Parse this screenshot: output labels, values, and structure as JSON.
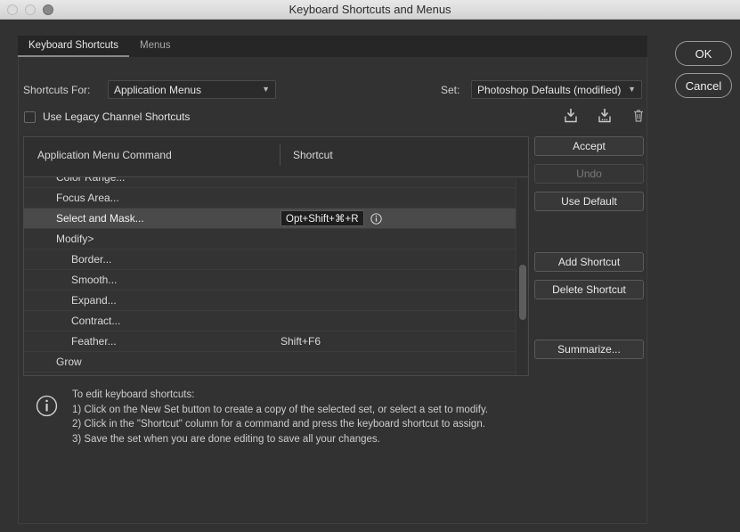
{
  "window": {
    "title": "Keyboard Shortcuts and Menus",
    "traffic_lights": [
      "close",
      "minimize",
      "zoom"
    ]
  },
  "tabs": [
    {
      "label": "Keyboard Shortcuts",
      "selected": true
    },
    {
      "label": "Menus",
      "selected": false
    }
  ],
  "controls": {
    "shortcuts_for_label": "Shortcuts For:",
    "shortcuts_for_value": "Application Menus",
    "set_label": "Set:",
    "set_value": "Photoshop Defaults (modified)",
    "legacy_checkbox_label": "Use Legacy Channel Shortcuts",
    "legacy_checkbox_checked": false
  },
  "set_icons": [
    {
      "name": "save-set-icon"
    },
    {
      "name": "save-set-as-icon"
    },
    {
      "name": "delete-set-icon"
    }
  ],
  "table": {
    "columns": [
      "Application Menu Command",
      "Shortcut"
    ],
    "rows": [
      {
        "command": "Color Range...",
        "indent": 1,
        "shortcut": "",
        "selected": false,
        "clipped_top": true,
        "has_info": false
      },
      {
        "command": "Focus Area...",
        "indent": 1,
        "shortcut": "",
        "selected": false,
        "has_info": false
      },
      {
        "command": "Select and Mask...",
        "indent": 1,
        "shortcut": "Opt+Shift+⌘+R",
        "selected": true,
        "has_info": true,
        "chip": true
      },
      {
        "command": "Modify>",
        "indent": 1,
        "shortcut": "",
        "selected": false,
        "has_info": false
      },
      {
        "command": "Border...",
        "indent": 2,
        "shortcut": "",
        "selected": false,
        "has_info": false
      },
      {
        "command": "Smooth...",
        "indent": 2,
        "shortcut": "",
        "selected": false,
        "has_info": false
      },
      {
        "command": "Expand...",
        "indent": 2,
        "shortcut": "",
        "selected": false,
        "has_info": false
      },
      {
        "command": "Contract...",
        "indent": 2,
        "shortcut": "",
        "selected": false,
        "has_info": false
      },
      {
        "command": "Feather...",
        "indent": 2,
        "shortcut": "Shift+F6",
        "selected": false,
        "has_info": false
      },
      {
        "command": "Grow",
        "indent": 1,
        "shortcut": "",
        "selected": false,
        "has_info": false
      }
    ]
  },
  "buttons": {
    "accept": "Accept",
    "undo": "Undo",
    "use_default": "Use Default",
    "add_shortcut": "Add Shortcut",
    "delete_shortcut": "Delete Shortcut",
    "summarize": "Summarize...",
    "ok": "OK",
    "cancel": "Cancel"
  },
  "help": {
    "heading": "To edit keyboard shortcuts:",
    "line1": "1) Click on the New Set button to create a copy of the selected set, or select a set to modify.",
    "line2": "2) Click in the \"Shortcut\" column for a command and press the keyboard shortcut to assign.",
    "line3": "3) Save the set when you are done editing to save all your changes."
  },
  "colors": {
    "dialog_background": "#323232",
    "panel_background": "#333333",
    "selected_row": "#4a4a4a",
    "text": "#d9d9d9",
    "titlebar": "#dcdcdc"
  }
}
